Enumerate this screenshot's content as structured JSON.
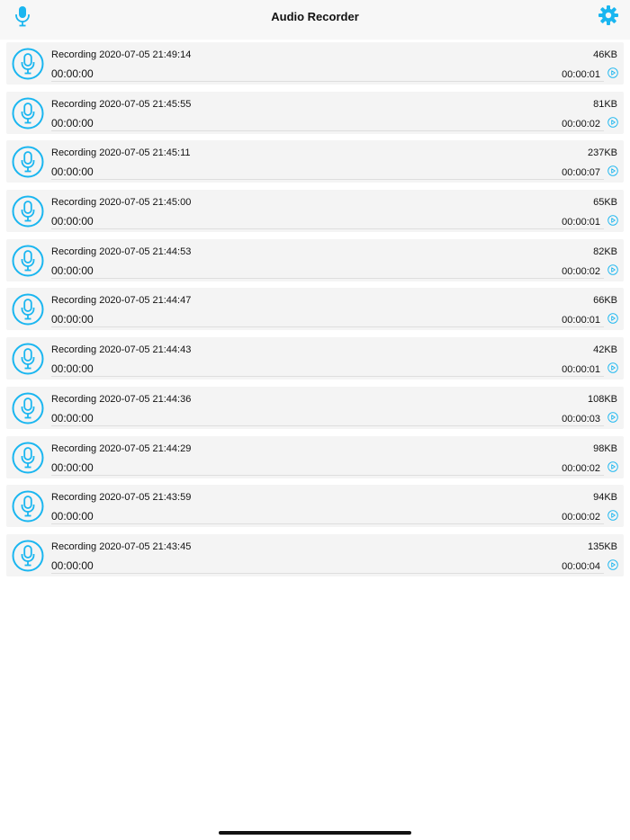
{
  "header": {
    "title": "Audio Recorder",
    "left_icon": "microphone-icon",
    "right_icon": "gear-icon"
  },
  "colors": {
    "accent": "#1ab6f0",
    "row_bg": "#f4f4f4",
    "header_bg": "#f7f7f7"
  },
  "recordings": [
    {
      "name": "Recording 2020-07-05 21:49:14",
      "size": "46KB",
      "elapsed": "00:00:00",
      "duration": "00:00:01"
    },
    {
      "name": "Recording 2020-07-05 21:45:55",
      "size": "81KB",
      "elapsed": "00:00:00",
      "duration": "00:00:02"
    },
    {
      "name": "Recording 2020-07-05 21:45:11",
      "size": "237KB",
      "elapsed": "00:00:00",
      "duration": "00:00:07"
    },
    {
      "name": "Recording 2020-07-05 21:45:00",
      "size": "65KB",
      "elapsed": "00:00:00",
      "duration": "00:00:01"
    },
    {
      "name": "Recording 2020-07-05 21:44:53",
      "size": "82KB",
      "elapsed": "00:00:00",
      "duration": "00:00:02"
    },
    {
      "name": "Recording 2020-07-05 21:44:47",
      "size": "66KB",
      "elapsed": "00:00:00",
      "duration": "00:00:01"
    },
    {
      "name": "Recording 2020-07-05 21:44:43",
      "size": "42KB",
      "elapsed": "00:00:00",
      "duration": "00:00:01"
    },
    {
      "name": "Recording 2020-07-05 21:44:36",
      "size": "108KB",
      "elapsed": "00:00:00",
      "duration": "00:00:03"
    },
    {
      "name": "Recording 2020-07-05 21:44:29",
      "size": "98KB",
      "elapsed": "00:00:00",
      "duration": "00:00:02"
    },
    {
      "name": "Recording 2020-07-05 21:43:59",
      "size": "94KB",
      "elapsed": "00:00:00",
      "duration": "00:00:02"
    },
    {
      "name": "Recording 2020-07-05 21:43:45",
      "size": "135KB",
      "elapsed": "00:00:00",
      "duration": "00:00:04"
    }
  ]
}
